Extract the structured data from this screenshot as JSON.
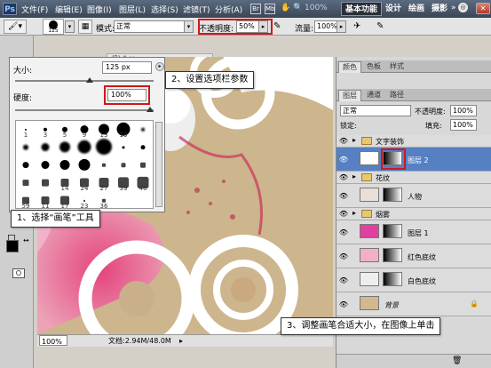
{
  "menubar": {
    "logo": "Ps",
    "items": [
      "文件(F)",
      "编辑(E)",
      "图像(I)",
      "图层(L)",
      "选择(S)",
      "滤镜(T)",
      "分析(A)"
    ],
    "zoom": "100%",
    "workspaces": [
      "基本功能",
      "设计",
      "绘画",
      "摄影"
    ],
    "more": "»",
    "cslive": "CS Live"
  },
  "options": {
    "brush_size": "125",
    "mode_label": "模式:",
    "mode_value": "正常",
    "opacity_label": "不透明度:",
    "opacity_value": "50%",
    "flow_label": "流量:",
    "flow_value": "100%"
  },
  "brushpicker": {
    "size_label": "大小:",
    "size_value": "125 px",
    "hardness_label": "硬度:",
    "hardness_value": "100%",
    "sizes": [
      "1",
      "3",
      "5",
      "9",
      "13",
      "19",
      "",
      "",
      "",
      "",
      "",
      "",
      "",
      "",
      "",
      "",
      "",
      "",
      "",
      "",
      "",
      "",
      "",
      "14",
      "24",
      "27",
      "39",
      "46",
      "59",
      "11",
      "17",
      "23",
      "36"
    ]
  },
  "canvas": {
    "doc_tab": "/8) *  ×",
    "status_zoom": "100%",
    "status_doc": "文档:2.94M/48.0M"
  },
  "panels": {
    "color_tabs": [
      "颜色",
      "色板",
      "样式"
    ],
    "layer_tabs": [
      "图层",
      "通道",
      "路径"
    ],
    "blend_mode": "正常",
    "opacity_label": "不透明度:",
    "opacity_value": "100%",
    "lock_label": "锁定:",
    "fill_label": "填充:",
    "fill_value": "100%",
    "layers": [
      {
        "name": "文字装饰",
        "type": "group"
      },
      {
        "name": "图层 2",
        "type": "layer",
        "selected": true
      },
      {
        "name": "花纹",
        "type": "group"
      },
      {
        "name": "人物",
        "type": "layer"
      },
      {
        "name": "烟雾",
        "type": "group"
      },
      {
        "name": "图层 1",
        "type": "layer"
      },
      {
        "name": "红色底纹",
        "type": "layer"
      },
      {
        "name": "白色底纹",
        "type": "layer"
      },
      {
        "name": "背景",
        "type": "background"
      }
    ]
  },
  "callouts": {
    "step1": "1、选择“画笔”工具",
    "step2": "2、设置选项栏参数",
    "step3": "3、调整画笔合适大小，在图像上单击"
  },
  "colors": {
    "accent_red": "#d01818",
    "selected_layer": "#5680c2"
  }
}
